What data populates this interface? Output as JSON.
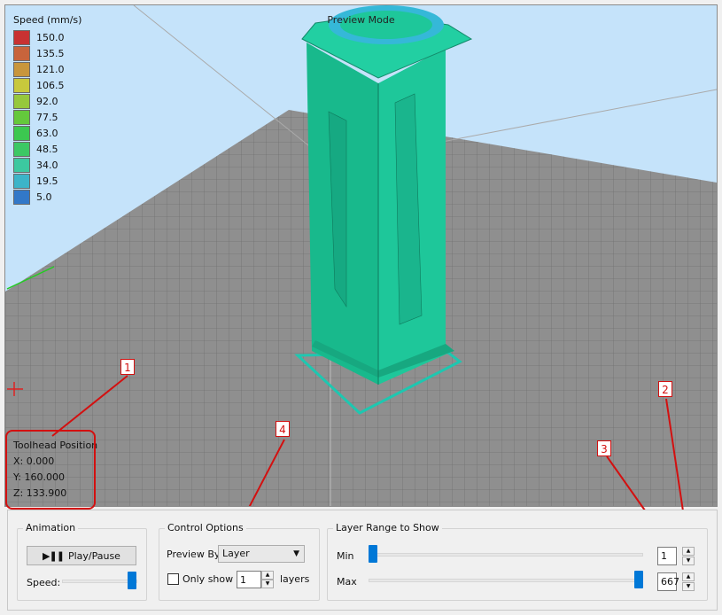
{
  "viewport": {
    "mode_label": "Preview Mode",
    "legend": {
      "title": "Speed (mm/s)",
      "items": [
        {
          "value": "150.0",
          "color": "#c83232"
        },
        {
          "value": "135.5",
          "color": "#c8643c"
        },
        {
          "value": "121.0",
          "color": "#c8963c"
        },
        {
          "value": "106.5",
          "color": "#c8c83c"
        },
        {
          "value": "92.0",
          "color": "#96c83c"
        },
        {
          "value": "77.5",
          "color": "#64c83c"
        },
        {
          "value": "63.0",
          "color": "#3cc850"
        },
        {
          "value": "48.5",
          "color": "#3cc864"
        },
        {
          "value": "34.0",
          "color": "#3cc8a0"
        },
        {
          "value": "19.5",
          "color": "#3cb4c8"
        },
        {
          "value": "5.0",
          "color": "#3278c8"
        }
      ]
    },
    "toolhead": {
      "title": "Toolhead Position",
      "x": "X: 0.000",
      "y": "Y: 160.000",
      "z": "Z: 133.900"
    },
    "model_color": "#1ec79a"
  },
  "annotations": {
    "m1": "1",
    "m2": "2",
    "m3": "3",
    "m4": "4"
  },
  "animation": {
    "title": "Animation",
    "play_label": "Play/Pause",
    "play_glyph": "▶❚❚",
    "speed_label": "Speed:"
  },
  "control_options": {
    "title": "Control Options",
    "preview_by_label": "Preview By",
    "preview_by_value": "Layer",
    "only_show_label": "Only show",
    "only_show_value": "1",
    "layers_label": "layers"
  },
  "layer_range": {
    "title": "Layer Range to Show",
    "min_label": "Min",
    "min_value": "1",
    "max_label": "Max",
    "max_value": "667"
  }
}
